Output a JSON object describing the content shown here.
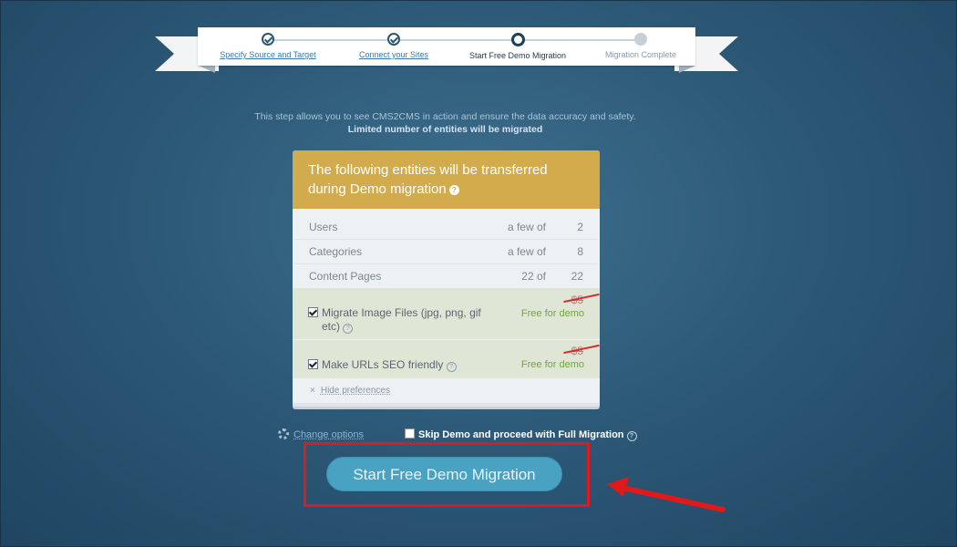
{
  "stepper": {
    "steps": [
      {
        "label": "Specify Source and Target",
        "state": "done"
      },
      {
        "label": "Connect your Sites",
        "state": "done"
      },
      {
        "label": "Start Free Demo Migration",
        "state": "current"
      },
      {
        "label": "Migration Complete",
        "state": "pending"
      }
    ]
  },
  "intro": {
    "line1": "This step allows you to see CMS2CMS in action and ensure the data accuracy and safety.",
    "line2": "Limited number of entities will be migrated"
  },
  "card": {
    "title": "The following entities will be transferred during Demo migration",
    "help_glyph": "?",
    "entities": [
      {
        "name": "Users",
        "prefix": "a few of",
        "count": "2"
      },
      {
        "name": "Categories",
        "prefix": "a few of",
        "count": "8"
      },
      {
        "name": "Content Pages",
        "prefix": "22 of",
        "count": "22"
      }
    ],
    "options": [
      {
        "label": "Migrate Image Files (jpg, png, gif etc)",
        "checked": true,
        "old_price": "$5",
        "free_label": "Free for demo"
      },
      {
        "label": "Make URLs SEO friendly",
        "checked": true,
        "old_price": "$5",
        "free_label": "Free for demo"
      }
    ],
    "hide_close": "×",
    "hide_label": "Hide preferences"
  },
  "footer": {
    "change_options": "Change options",
    "skip_label": "Skip Demo and proceed with Full Migration",
    "start_button": "Start Free Demo Migration"
  },
  "colors": {
    "header_gold": "#d2ac4c",
    "button": "#4aa2c2",
    "highlight": "#e01a1a",
    "free_green": "#6fa63a"
  }
}
